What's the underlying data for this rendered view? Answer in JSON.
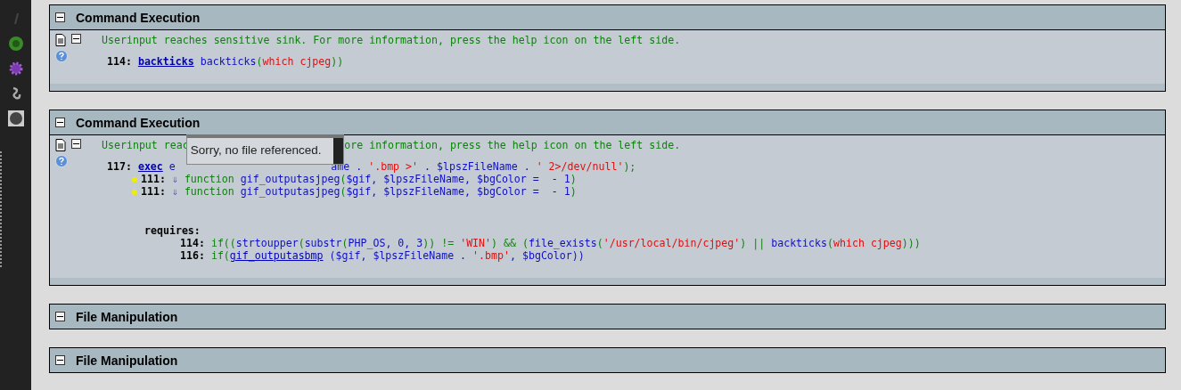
{
  "sections": [
    {
      "title": "Command Execution",
      "message": [
        "Userinput reaches sensitive sink. For more information, press the help icon on the left side."
      ],
      "sink": {
        "line": "114:",
        "tokens": [
          {
            "kind": "link",
            "text": "backticks"
          },
          {
            "kind": "fn",
            "text": " backticks"
          },
          {
            "kind": "op",
            "text": "("
          },
          {
            "kind": "str",
            "text": "which cjpeg"
          },
          {
            "kind": "op",
            "text": "))"
          }
        ]
      }
    },
    {
      "title": "Command Execution",
      "message": [
        "Userinput reac",
        "ore information, press the help icon on the left side."
      ],
      "tooltip": "Sorry, no file referenced.",
      "sink": {
        "line": "117:",
        "tokens": [
          {
            "kind": "link",
            "text": "exec"
          },
          {
            "kind": "fn",
            "text": " e"
          },
          {
            "kind": "covered"
          },
          {
            "kind": "var",
            "text": "ame . "
          },
          {
            "kind": "str",
            "text": "'.bmp >'"
          },
          {
            "kind": "var",
            "text": " . $lpszFileName . "
          },
          {
            "kind": "str",
            "text": "' 2>/dev/null'"
          },
          {
            "kind": "op",
            "text": ");"
          }
        ]
      },
      "trace": [
        {
          "line": "111:",
          "arrow": "⇓",
          "tokens": [
            {
              "kind": "op",
              "text": "function "
            },
            {
              "kind": "fn",
              "text": "gif_outputasjpeg"
            },
            {
              "kind": "op",
              "text": "("
            },
            {
              "kind": "var",
              "text": "$gif, $lpszFileName, $bgColor =  - 1"
            },
            {
              "kind": "op",
              "text": ")"
            }
          ]
        },
        {
          "line": "111:",
          "arrow": "⇓",
          "tokens": [
            {
              "kind": "op",
              "text": "function "
            },
            {
              "kind": "fn",
              "text": "gif_outputasjpeg"
            },
            {
              "kind": "op",
              "text": "("
            },
            {
              "kind": "var",
              "text": "$gif, $lpszFileName, $bgColor =  - 1"
            },
            {
              "kind": "op",
              "text": ")"
            }
          ]
        }
      ],
      "requires": {
        "label": "requires:",
        "lines": [
          {
            "line": "114:",
            "tokens": [
              {
                "kind": "op",
                "text": "if(("
              },
              {
                "kind": "fn",
                "text": "strtoupper"
              },
              {
                "kind": "op",
                "text": "("
              },
              {
                "kind": "fn",
                "text": "substr"
              },
              {
                "kind": "op",
                "text": "("
              },
              {
                "kind": "var",
                "text": "PHP_OS, 0, 3"
              },
              {
                "kind": "op",
                "text": ")) != "
              },
              {
                "kind": "str",
                "text": "'WIN'"
              },
              {
                "kind": "op",
                "text": ") && ("
              },
              {
                "kind": "fn",
                "text": "file_exists"
              },
              {
                "kind": "op",
                "text": "("
              },
              {
                "kind": "str",
                "text": "'/usr/local/bin/cjpeg'"
              },
              {
                "kind": "op",
                "text": ") || "
              },
              {
                "kind": "fn",
                "text": "backticks"
              },
              {
                "kind": "op",
                "text": "("
              },
              {
                "kind": "str",
                "text": "which cjpeg"
              },
              {
                "kind": "op",
                "text": ")))"
              }
            ]
          },
          {
            "line": "116:",
            "tokens": [
              {
                "kind": "op",
                "text": "if("
              },
              {
                "kind": "ref",
                "text": "gif_outputasbmp"
              },
              {
                "kind": "var",
                "text": " ($gif, $lpszFileName . "
              },
              {
                "kind": "str",
                "text": "'.bmp'"
              },
              {
                "kind": "var",
                "text": ", $bgColor))"
              }
            ]
          }
        ]
      }
    },
    {
      "title": "File Manipulation"
    },
    {
      "title": "File Manipulation"
    }
  ]
}
